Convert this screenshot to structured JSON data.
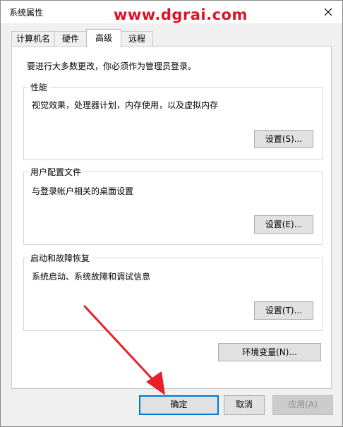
{
  "window": {
    "title": "系统属性",
    "watermark": "www.dgrai.com",
    "close_icon": "close-icon"
  },
  "tabs": [
    {
      "label": "计算机名"
    },
    {
      "label": "硬件"
    },
    {
      "label": "高级",
      "active": true
    },
    {
      "label": "远程"
    }
  ],
  "advanced": {
    "intro": "要进行大多数更改，你必须作为管理员登录。",
    "performance": {
      "title": "性能",
      "description": "视觉效果，处理器计划，内存使用，以及虚拟内存",
      "button": "设置(S)..."
    },
    "user_profiles": {
      "title": "用户配置文件",
      "description": "与登录帐户相关的桌面设置",
      "button": "设置(E)..."
    },
    "startup_recovery": {
      "title": "启动和故障恢复",
      "description": "系统启动、系统故障和调试信息",
      "button": "设置(T)..."
    },
    "env_button": "环境变量(N)..."
  },
  "footer": {
    "ok": "确定",
    "cancel": "取消",
    "apply": "应用(A)"
  },
  "colors": {
    "watermark": "#e0102a",
    "annotation_arrow": "#e8202a",
    "focus_border": "#0078d7"
  }
}
